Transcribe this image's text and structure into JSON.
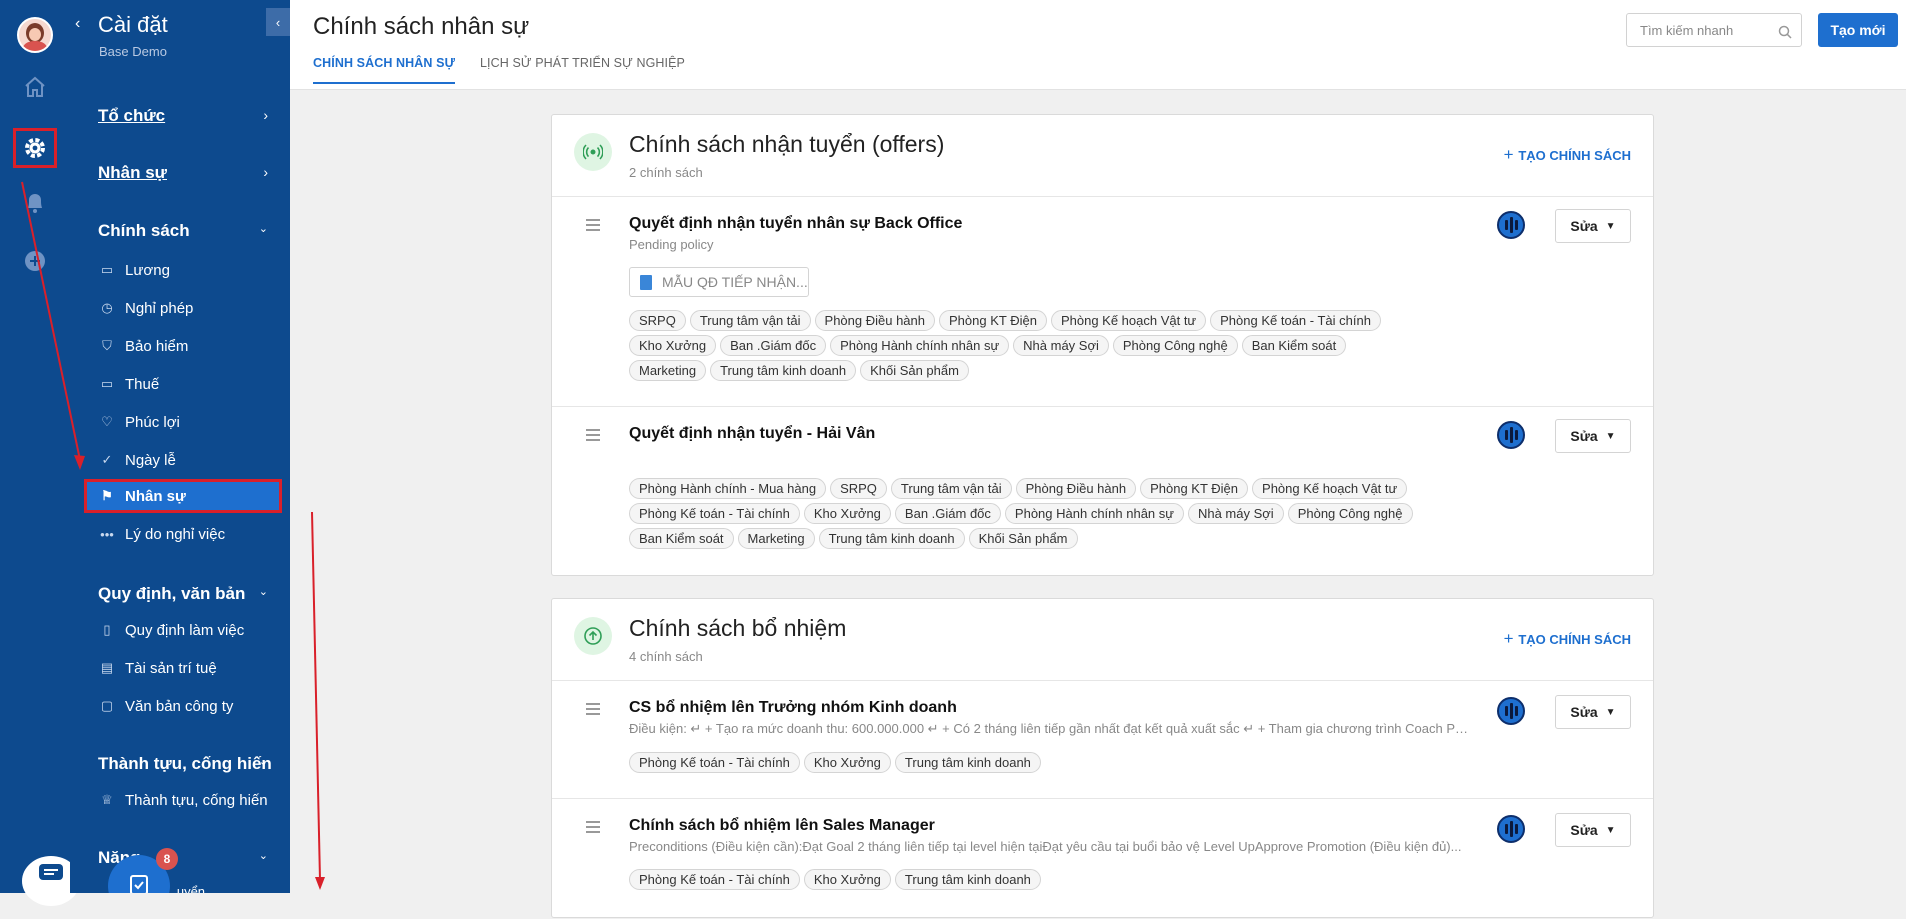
{
  "sidebar": {
    "title": "Cài đặt",
    "subtitle": "Base Demo",
    "sections": [
      {
        "label": "Tổ chức"
      },
      {
        "label": "Nhân sự"
      },
      {
        "label": "Chính sách"
      },
      {
        "label": "Quy định, văn bản"
      },
      {
        "label": "Thành tựu, cống hiến"
      },
      {
        "label": "Năng..."
      }
    ],
    "policy_items": [
      {
        "label": "Lương",
        "icon": "wallet-icon"
      },
      {
        "label": "Nghỉ phép",
        "icon": "clock-icon"
      },
      {
        "label": "Bảo hiểm",
        "icon": "shield-icon"
      },
      {
        "label": "Thuế",
        "icon": "tax-icon"
      },
      {
        "label": "Phúc lợi",
        "icon": "heart-icon"
      },
      {
        "label": "Ngày lễ",
        "icon": "check-circle-icon"
      },
      {
        "label": "Nhân sự",
        "icon": "flag-icon"
      },
      {
        "label": "Lý do nghỉ việc",
        "icon": "dots-icon"
      }
    ],
    "rule_items": [
      {
        "label": "Quy định làm việc",
        "icon": "book-icon"
      },
      {
        "label": "Tài sản trí tuệ",
        "icon": "document-icon"
      },
      {
        "label": "Văn bản công ty",
        "icon": "file-icon"
      }
    ],
    "achieve_items": [
      {
        "label": "Thành tựu, cống hiến",
        "icon": "crown-icon"
      }
    ],
    "badge_count": "8",
    "cut_text": "...uyển"
  },
  "header": {
    "title": "Chính sách nhân sự",
    "tabs": [
      "CHÍNH SÁCH NHÂN SỰ",
      "LỊCH SỬ PHÁT TRIỂN SỰ NGHIỆP"
    ],
    "search_placeholder": "Tìm kiếm nhanh",
    "new_button": "Tạo mới"
  },
  "cards": [
    {
      "title": "Chính sách nhận tuyển (offers)",
      "count": "2 chính sách",
      "create_label": "TẠO CHÍNH SÁCH",
      "icon": "broadcast-icon",
      "policies": [
        {
          "title": "Quyết định nhận tuyển nhân sự Back Office",
          "subtitle": "Pending policy",
          "doc": "MẪU QĐ TIẾP NHẬN...",
          "tags": [
            "SRPQ",
            "Trung tâm vận tải",
            "Phòng Điều hành",
            "Phòng KT Điện",
            "Phòng Kế hoạch Vật tư",
            "Phòng Kế toán - Tài chính",
            "Kho Xưởng",
            "Ban .Giám đốc",
            "Phòng Hành chính nhân sự",
            "Nhà máy Sợi",
            "Phòng Công nghệ",
            "Ban Kiểm soát",
            "Marketing",
            "Trung tâm kinh doanh",
            "Khối Sản phẩm"
          ],
          "edit": "Sửa"
        },
        {
          "title": "Quyết định nhận tuyển - Hải Vân",
          "tags": [
            "Phòng Hành chính - Mua hàng",
            "SRPQ",
            "Trung tâm vận tải",
            "Phòng Điều hành",
            "Phòng KT Điện",
            "Phòng Kế hoạch Vật tư",
            "Phòng Kế toán - Tài chính",
            "Kho Xưởng",
            "Ban .Giám đốc",
            "Phòng Hành chính nhân sự",
            "Nhà máy Sợi",
            "Phòng Công nghệ",
            "Ban Kiểm soát",
            "Marketing",
            "Trung tâm kinh doanh",
            "Khối Sản phẩm"
          ],
          "edit": "Sửa"
        }
      ]
    },
    {
      "title": "Chính sách bổ nhiệm",
      "count": "4 chính sách",
      "create_label": "TẠO CHÍNH SÁCH",
      "icon": "arrow-up-circle-icon",
      "policies": [
        {
          "title": "CS bổ nhiệm lên Trưởng nhóm Kinh doanh",
          "subtitle": "Điều kiện: ↵ + Tạo ra mức doanh thu: 600.000.000 ↵ + Có 2 tháng liên tiếp gần nhất đạt kết quả xuất sắc ↵ + Tham gia chương trình Coach Pr...",
          "tags": [
            "Phòng Kế toán - Tài chính",
            "Kho Xưởng",
            "Trung tâm kinh doanh"
          ],
          "edit": "Sửa"
        },
        {
          "title": "Chính sách bổ nhiệm lên Sales Manager",
          "subtitle": "Preconditions (Điều kiện cần):Đạt Goal 2 tháng liên tiếp tại level hiện tạiĐạt yêu cầu tại buổi bảo vệ Level UpApprove Promotion (Điều kiện đủ)...",
          "tags": [
            "Phòng Kế toán - Tài chính",
            "Kho Xưởng",
            "Trung tâm kinh doanh"
          ],
          "edit": "Sửa"
        }
      ]
    }
  ],
  "colors": {
    "sidebar": "#0d4a8e",
    "accent": "#1e6fcf",
    "highlight": "#d9202a"
  }
}
